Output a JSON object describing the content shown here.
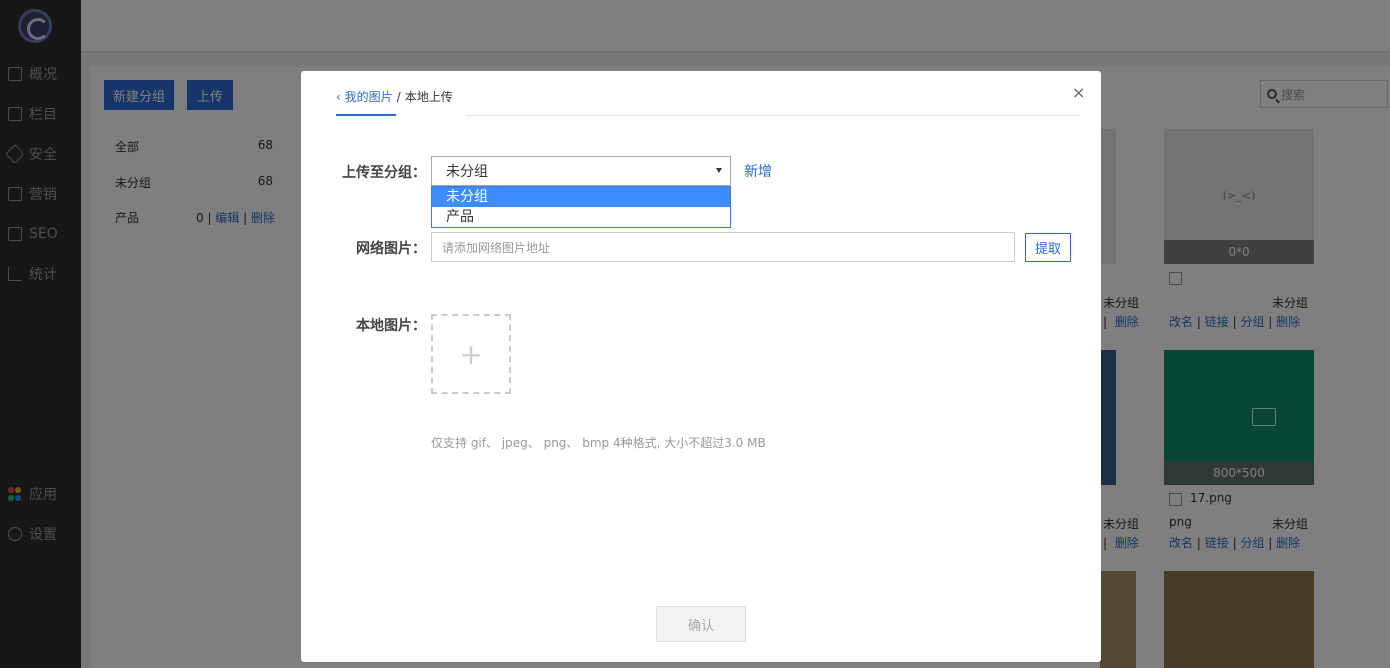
{
  "sidebar": {
    "items": [
      {
        "label": "概况",
        "icon": "monitor-icon"
      },
      {
        "label": "栏目",
        "icon": "document-icon"
      },
      {
        "label": "安全",
        "icon": "tag-icon"
      },
      {
        "label": "营销",
        "icon": "book-icon"
      },
      {
        "label": "SEO",
        "icon": "seo-icon"
      },
      {
        "label": "统计",
        "icon": "bar-chart-icon"
      }
    ],
    "bottom": [
      {
        "label": "应用",
        "icon": "apps-icon"
      },
      {
        "label": "设置",
        "icon": "gear-icon"
      }
    ]
  },
  "toolbar": {
    "new_group": "新建分组",
    "upload": "上传",
    "search_placeholder": "搜索"
  },
  "groups": [
    {
      "name": "全部",
      "count": "68"
    },
    {
      "name": "未分组",
      "count": "68"
    },
    {
      "name": "产品",
      "count": "0",
      "edit": "编辑",
      "delete": "删除"
    }
  ],
  "cards": [
    {
      "size": "0*0",
      "group": "未分组",
      "placeholder": "(>_<)"
    },
    {
      "size": "800*500",
      "name": "17.png",
      "type": "png",
      "group": "未分组"
    }
  ],
  "card_actions": {
    "rename": "改名",
    "link": "链接",
    "group": "分组",
    "delete": "删除",
    "sep": "|"
  },
  "partial_cards": [
    {
      "group": "未分组",
      "delete": "删除"
    },
    {
      "group": "未分组",
      "delete": "删除"
    }
  ],
  "modal": {
    "back_link": "我的图片",
    "separator": "/",
    "current": "本地上传",
    "close": "×",
    "upload_to_label": "上传至分组：",
    "selected_group": "未分组",
    "options": [
      "未分组",
      "产品"
    ],
    "add_new": "新增",
    "web_image_label": "网络图片：",
    "web_image_placeholder": "请添加网络图片地址",
    "fetch": "提取",
    "local_image_label": "本地图片：",
    "plus": "+",
    "hint": "仅支持 gif、 jpeg、 png、 bmp 4种格式, 大小不超过3.0 MB",
    "confirm": "确认"
  },
  "colors": {
    "accent": "#2d6bd0",
    "sidebar": "#2f2f2f",
    "dropdown_selected": "#3c8dff"
  }
}
